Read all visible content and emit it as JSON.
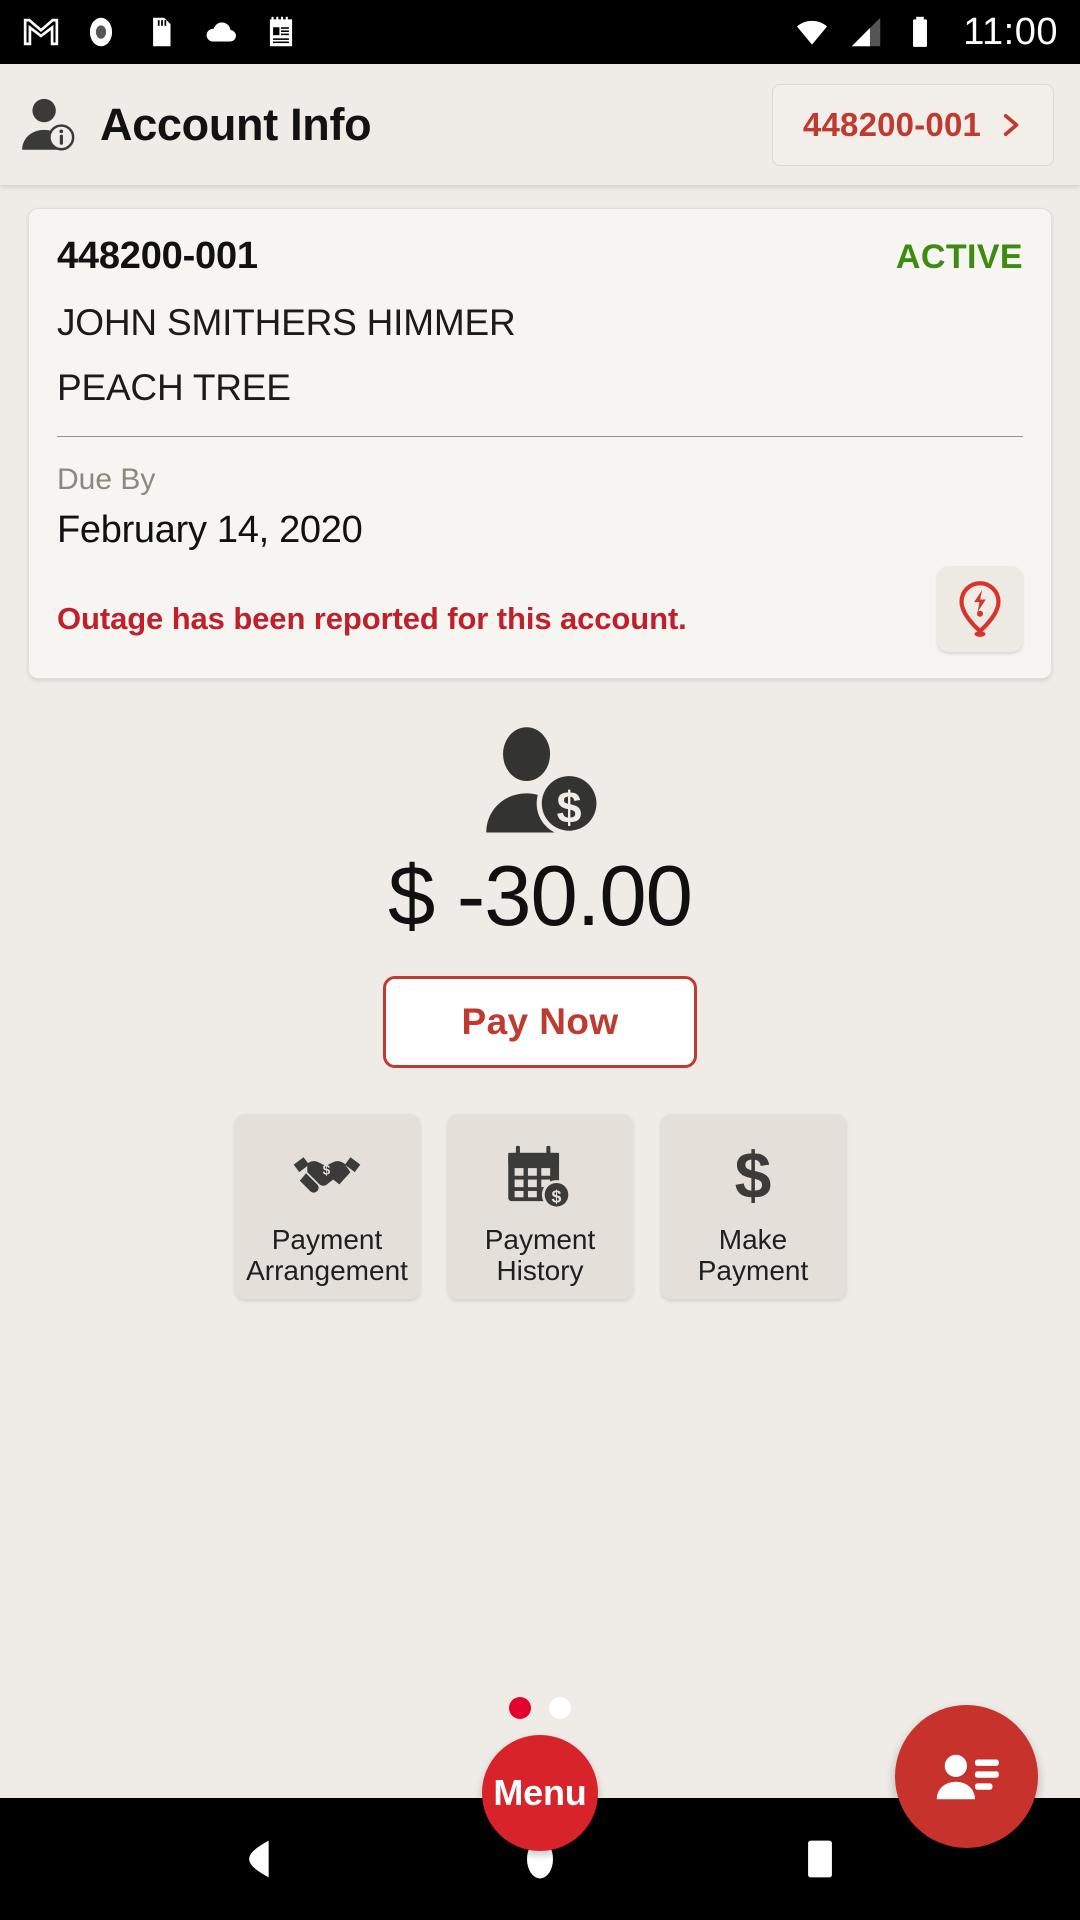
{
  "status_bar": {
    "time": "11:00",
    "left_icons": [
      "gmail-icon",
      "record-icon",
      "sd-card-icon",
      "cloud-icon",
      "notepad-icon"
    ],
    "right_icons": [
      "wifi-icon",
      "cellular-signal-icon",
      "battery-icon"
    ]
  },
  "header": {
    "title": "Account Info",
    "icon": "person-info-icon",
    "account_switcher": {
      "label": "448200-001",
      "chevron": "chevron-right-icon"
    }
  },
  "account_card": {
    "account_number": "448200-001",
    "status": "ACTIVE",
    "status_color": "#3D8B10",
    "customer_name": "JOHN SMITHERS HIMMER",
    "address": "PEACH TREE",
    "due_by_label": "Due By",
    "due_by_date": "February 14, 2020",
    "outage_message": "Outage has been reported for this account.",
    "outage_color": "#C0202B",
    "outage_icon": "outage-pin-icon"
  },
  "balance": {
    "icon": "person-dollar-icon",
    "amount": "$ -30.00",
    "pay_now_label": "Pay Now",
    "accent_color": "#BF3A2F"
  },
  "tiles": [
    {
      "icon": "handshake-dollar-icon",
      "line1": "Payment",
      "line2": "Arrangement"
    },
    {
      "icon": "calendar-dollar-icon",
      "line1": "Payment",
      "line2": "History"
    },
    {
      "icon": "dollar-sign-icon",
      "line1": "Make",
      "line2": "Payment"
    }
  ],
  "pagination": {
    "total": 2,
    "active_index": 0,
    "active_color": "#E4032E",
    "inactive_color": "#FFFFFF"
  },
  "menu_fab": {
    "label": "Menu",
    "color": "#D8232A"
  },
  "contact_fab": {
    "icon": "contact-card-icon",
    "color": "#C8322C"
  },
  "nav_bar": {
    "buttons": [
      "back-nav-icon",
      "home-nav-icon",
      "recents-nav-icon"
    ]
  },
  "theme": {
    "page_background": "#EFEBE6",
    "card_background": "#F7F5F1",
    "tile_background": "#E4DFD9"
  }
}
